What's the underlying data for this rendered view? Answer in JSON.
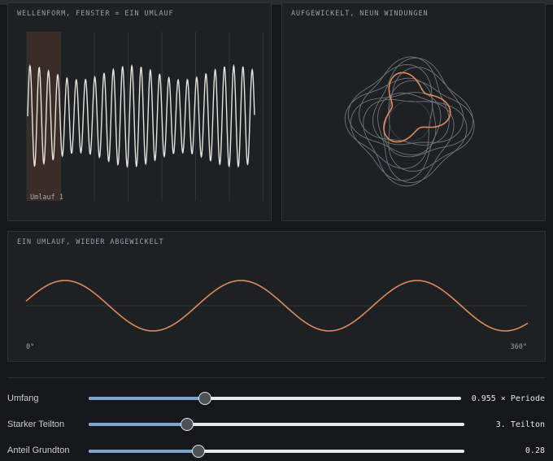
{
  "panels": {
    "waveform": {
      "title": "Wellenform, Fenster = ein Umlauf",
      "window_label": "Umlauf 1"
    },
    "wound": {
      "title": "Aufgewickelt, neun Windungen"
    },
    "unwound": {
      "title": "Ein Umlauf, wieder abgewickelt",
      "axis_start": "0°",
      "axis_end": "360°"
    }
  },
  "controls": [
    {
      "label": "Umfang",
      "value_text": "0.955 × Periode",
      "position": 0.31
    },
    {
      "label": "Starker Teilton",
      "value_text": "3. Teilton",
      "position": 0.26
    },
    {
      "label": "Anteil Grundton",
      "value_text": "0.28",
      "position": 0.29
    }
  ],
  "colors": {
    "accent": "#e08a5a",
    "slider_fill": "#7ea3cf",
    "wave": "#e6e2dc",
    "window_shade": "#3a2d28"
  }
}
